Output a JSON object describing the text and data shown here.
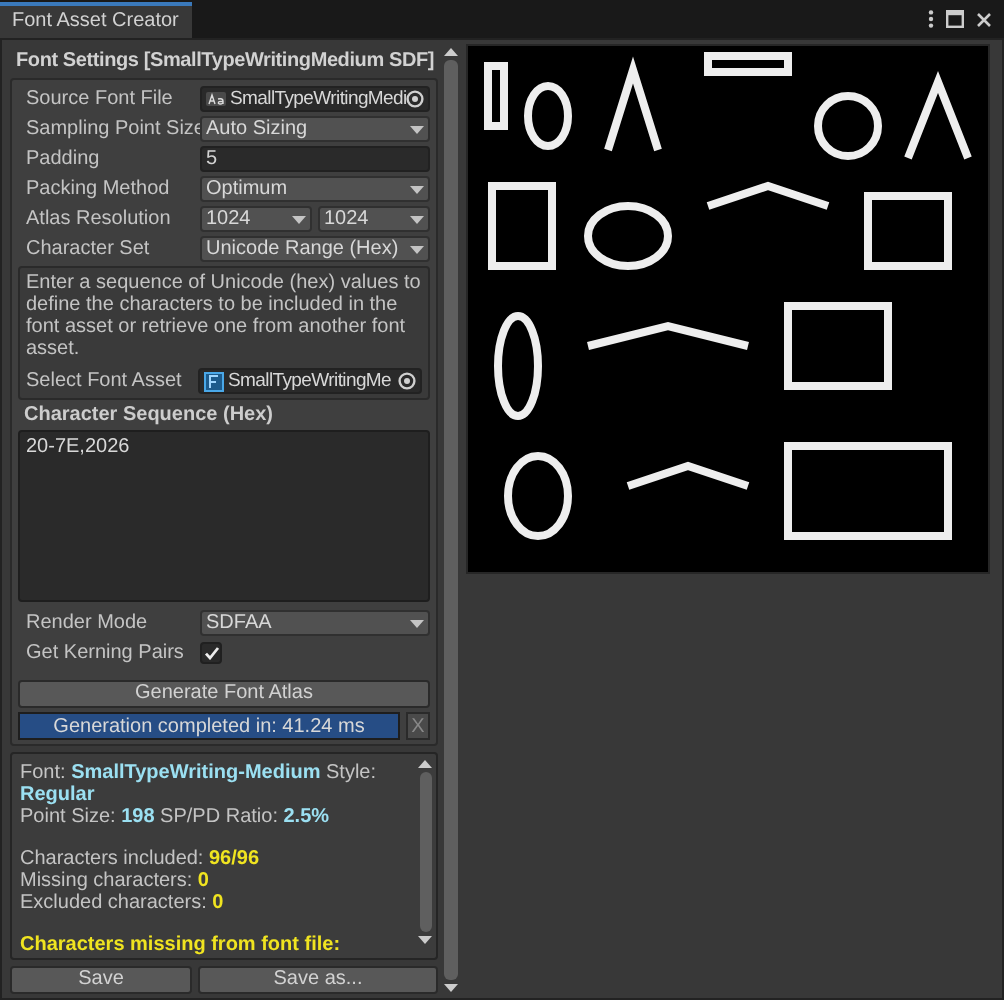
{
  "window": {
    "tab": "Font Asset Creator"
  },
  "settings": {
    "title": "Font Settings [SmallTypeWritingMedium SDF]",
    "fields": [
      {
        "label": "Source Font File",
        "kind": "object",
        "value": "SmallTypeWritingMedi"
      },
      {
        "label": "Sampling Point Size",
        "kind": "dropdown",
        "value": "Auto Sizing"
      },
      {
        "label": "Padding",
        "kind": "text",
        "value": "5"
      },
      {
        "label": "Packing Method",
        "kind": "dropdown",
        "value": "Optimum"
      },
      {
        "label": "Atlas Resolution",
        "kind": "pair",
        "values": [
          "1024",
          "1024"
        ]
      },
      {
        "label": "Character Set",
        "kind": "dropdown",
        "value": "Unicode Range (Hex)"
      }
    ],
    "help_text": "Enter a sequence of Unicode (hex) values to define the characters to be included in the font asset or retrieve one from another font asset.",
    "font_asset": {
      "label": "Select Font Asset",
      "value": "SmallTypeWritingMe"
    },
    "sequence": {
      "label": "Character Sequence (Hex)",
      "value": "20-7E,2026"
    },
    "render_mode": {
      "label": "Render Mode",
      "value": "SDFAA"
    },
    "kerning": {
      "label": "Get Kerning Pairs",
      "checked": true
    },
    "generate_button": "Generate Font Atlas",
    "progress": {
      "text": "Generation completed in: 41.24 ms",
      "level": 1,
      "close": "X"
    }
  },
  "info": {
    "groups": [
      {
        "kind": "font",
        "lines": [
          "Font: **SmallTypeWriting-Medium**  Style: **Regular**",
          "Point Size: **198**   SP/PD Ratio: **2.5%**"
        ]
      },
      {
        "kind": "count",
        "lines": [
          "Characters included: **96/96**",
          "Missing characters: **0**",
          "Excluded characters: **0**"
        ]
      },
      {
        "kind": "warning",
        "lines": [
          "Characters missing from font file:"
        ]
      }
    ]
  },
  "buttons": [
    "Save",
    "Save as..."
  ]
}
